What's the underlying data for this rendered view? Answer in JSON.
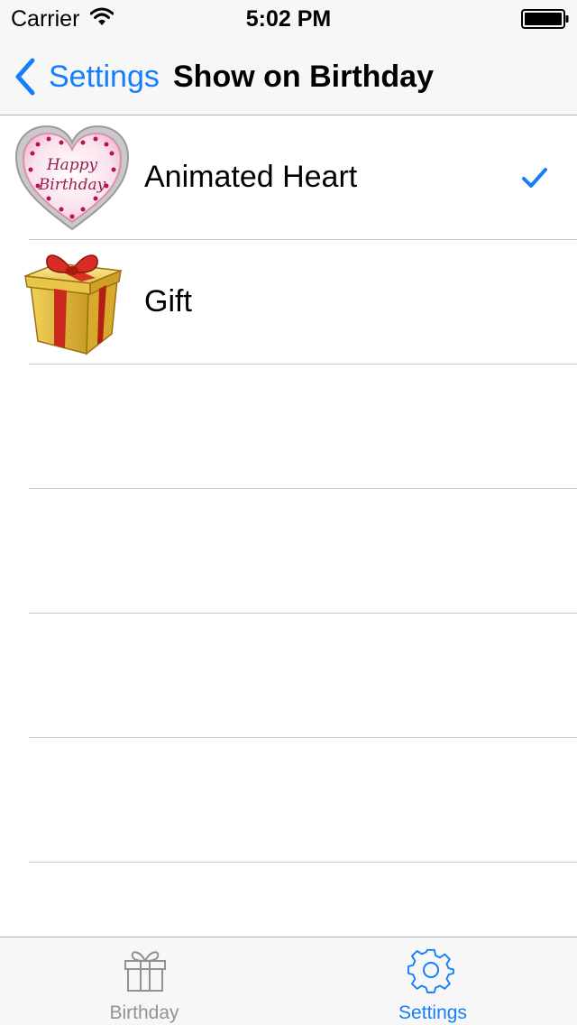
{
  "status_bar": {
    "carrier": "Carrier",
    "time": "5:02 PM"
  },
  "nav": {
    "back_label": "Settings",
    "title": "Show on Birthday"
  },
  "options": [
    {
      "label": "Animated Heart",
      "image": "happy-birthday-heart-image",
      "selected": true
    },
    {
      "label": "Gift",
      "image": "gift-box-image",
      "selected": false
    }
  ],
  "heart_text": {
    "line1": "Happy",
    "line2": "Birthday"
  },
  "tabs": [
    {
      "label": "Birthday",
      "icon": "gift-icon",
      "active": false
    },
    {
      "label": "Settings",
      "icon": "gear-icon",
      "active": true
    }
  ],
  "colors": {
    "accent": "#147efb",
    "inactive_tab": "#929292",
    "separator": "#c8c7cc",
    "bar_background": "#f7f7f7"
  }
}
